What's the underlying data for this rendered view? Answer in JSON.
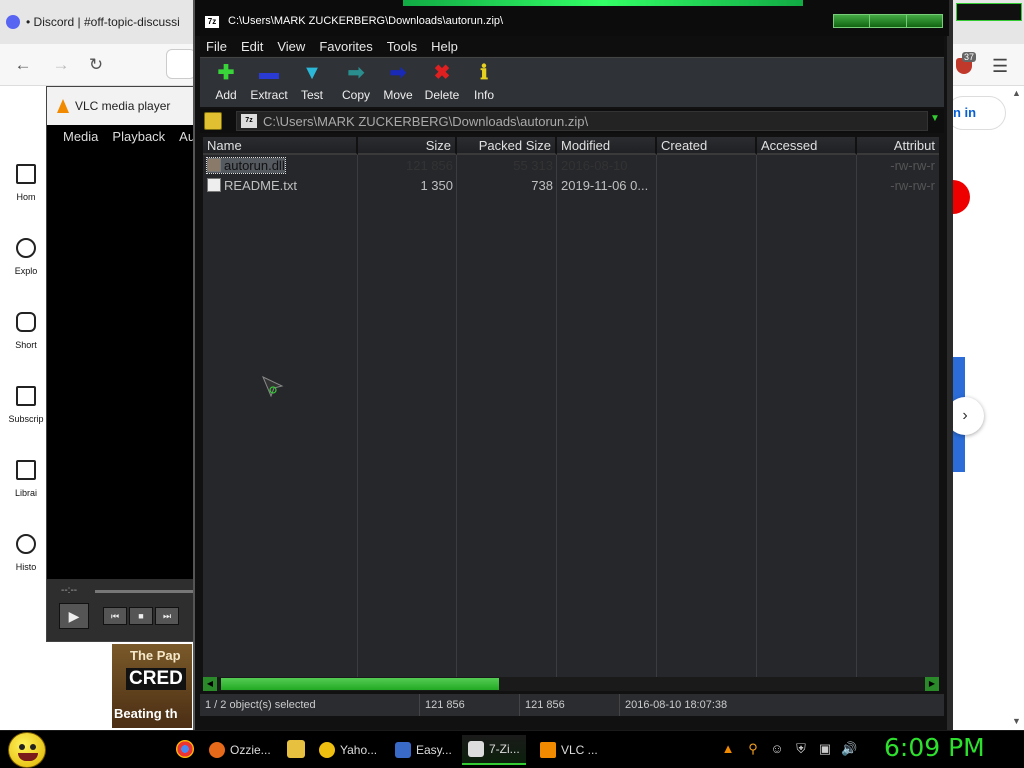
{
  "browser": {
    "tab_title": "• Discord | #off-topic-discussi",
    "extension_count": "37",
    "signin_label": "n in"
  },
  "youtube": {
    "sidebar": [
      {
        "label": "Hom",
        "icon": "home-icon"
      },
      {
        "label": "Explo",
        "icon": "compass-icon"
      },
      {
        "label": "Short",
        "icon": "shorts-icon"
      },
      {
        "label": "Subscrip",
        "icon": "subscriptions-icon"
      },
      {
        "label": "Librai",
        "icon": "library-icon"
      },
      {
        "label": "Histo",
        "icon": "history-icon"
      }
    ],
    "thumb": {
      "line1": "The Pap",
      "line2": "CRED",
      "line3": "Beating th"
    }
  },
  "vlc": {
    "title": "VLC media player",
    "menu": [
      "Media",
      "Playback",
      "Au"
    ],
    "time": "--:--"
  },
  "zip": {
    "title": "C:\\Users\\MARK ZUCKERBERG\\Downloads\\autorun.zip\\",
    "icon_label": "7z",
    "menu": [
      "File",
      "Edit",
      "View",
      "Favorites",
      "Tools",
      "Help"
    ],
    "toolbar": [
      {
        "label": "Add",
        "glyph": "✚",
        "color": "#39d439",
        "icon": "add-icon"
      },
      {
        "label": "Extract",
        "glyph": "▬",
        "color": "#2a3bd4",
        "icon": "extract-icon"
      },
      {
        "label": "Test",
        "glyph": "▼",
        "color": "#2bb8d8",
        "icon": "test-icon"
      },
      {
        "label": "Copy",
        "glyph": "➡",
        "color": "#2a8e8e",
        "icon": "copy-icon"
      },
      {
        "label": "Move",
        "glyph": "➡",
        "color": "#1a2ab8",
        "icon": "move-icon"
      },
      {
        "label": "Delete",
        "glyph": "✖",
        "color": "#e02020",
        "icon": "delete-icon"
      },
      {
        "label": "Info",
        "glyph": "ℹ",
        "color": "#e6d020",
        "icon": "info-icon"
      }
    ],
    "address": "C:\\Users\\MARK ZUCKERBERG\\Downloads\\autorun.zip\\",
    "columns": [
      "Name",
      "Size",
      "Packed Size",
      "Modified",
      "Created",
      "Accessed",
      "Attribut"
    ],
    "files": [
      {
        "name": "autorun.dll",
        "size": "121 856",
        "packed": "55 313",
        "modified": "2016-08-10",
        "created": "",
        "accessed": "",
        "attrib": "-rw-rw-r",
        "selected": true
      },
      {
        "name": "README.txt",
        "size": "1 350",
        "packed": "738",
        "modified": "2019-11-06 0...",
        "created": "",
        "accessed": "",
        "attrib": "-rw-rw-r",
        "selected": false
      }
    ],
    "status": {
      "selected": "1 / 2 object(s) selected",
      "size": "121 856",
      "packed": "121 856",
      "date": "2016-08-10 18:07:38"
    }
  },
  "taskbar": {
    "tasks": [
      {
        "label": "Ozzie...",
        "color": "#e66a1a",
        "icon": "firefox-icon"
      },
      {
        "label": "Yaho...",
        "color": "#f0c010",
        "icon": "yahoo-smiley-icon"
      },
      {
        "label": "Easy...",
        "color": "#3a6ac8",
        "icon": "easy-app-icon"
      },
      {
        "label": "7-Zi...",
        "color": "#dddddd",
        "icon": "7zip-icon"
      },
      {
        "label": "VLC ...",
        "color": "#f28a00",
        "icon": "vlc-icon"
      }
    ],
    "clock": "6:09 PM"
  }
}
